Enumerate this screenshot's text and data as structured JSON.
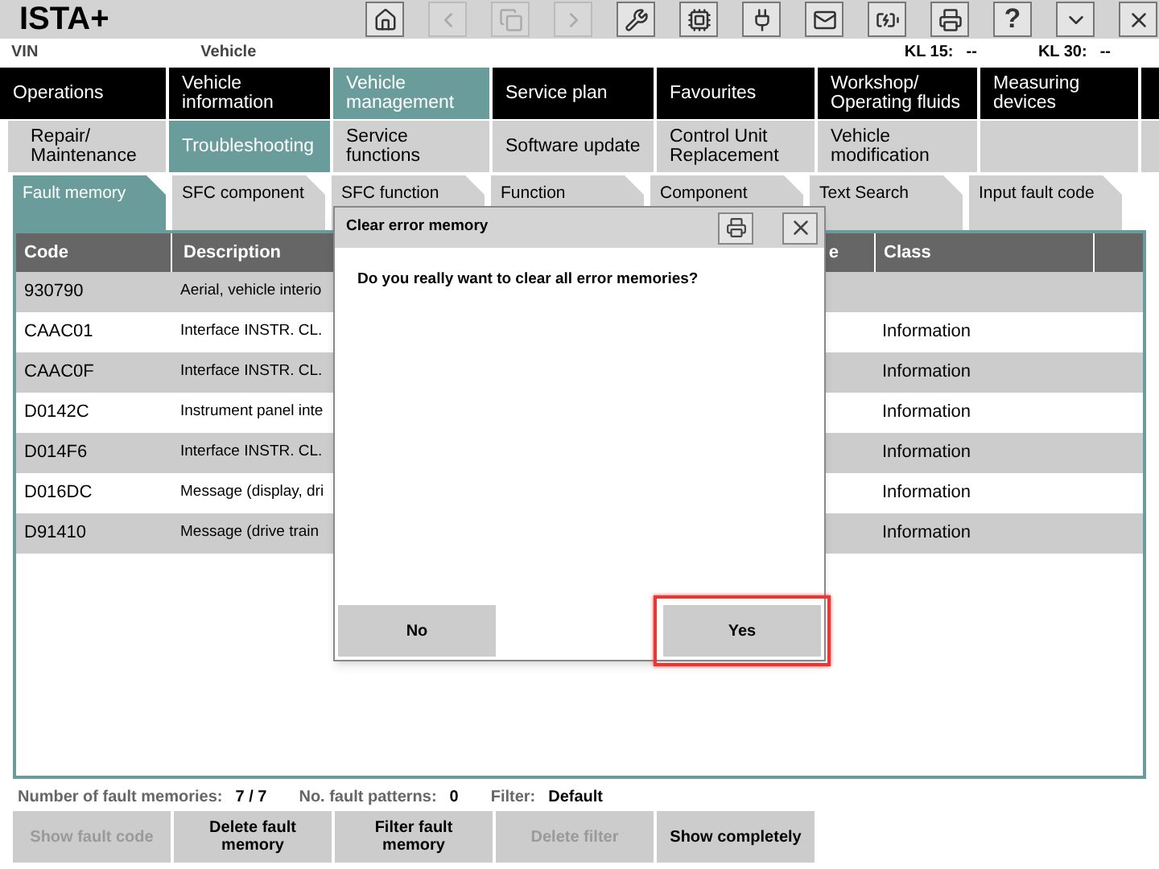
{
  "app_title": "ISTA+",
  "toolbar": [
    {
      "kind": "home",
      "disabled": false
    },
    {
      "kind": "back",
      "disabled": true
    },
    {
      "kind": "copy",
      "disabled": true
    },
    {
      "kind": "forward",
      "disabled": true
    },
    {
      "kind": "wrench",
      "disabled": false
    },
    {
      "kind": "module",
      "disabled": false
    },
    {
      "kind": "plug",
      "disabled": false
    },
    {
      "kind": "mail",
      "disabled": false
    },
    {
      "kind": "battery",
      "disabled": false
    },
    {
      "kind": "printer",
      "disabled": false
    },
    {
      "kind": "text",
      "label": "?",
      "disabled": false
    },
    {
      "kind": "dropdown",
      "disabled": false
    },
    {
      "kind": "close",
      "disabled": false
    }
  ],
  "vehicle_bar": {
    "vin_label": "VIN",
    "vehicle_label": "Vehicle",
    "kl15_label": "KL 15:",
    "kl15_value": "--",
    "kl30_label": "KL 30:",
    "kl30_value": "--"
  },
  "main_nav": [
    {
      "label": "Operations",
      "selected": false
    },
    {
      "label": "Vehicle information",
      "selected": false
    },
    {
      "label": "Vehicle management",
      "selected": true
    },
    {
      "label": "Service plan",
      "selected": false
    },
    {
      "label": "Favourites",
      "selected": false
    },
    {
      "label": "Workshop/ Operating fluids",
      "selected": false
    },
    {
      "label": "Measuring devices",
      "selected": false
    }
  ],
  "sub_nav": [
    {
      "label": "Repair/ Maintenance",
      "selected": false
    },
    {
      "label": "Troubleshooting",
      "selected": true
    },
    {
      "label": "Service functions",
      "selected": false
    },
    {
      "label": "Software update",
      "selected": false
    },
    {
      "label": "Control Unit Replacement",
      "selected": false
    },
    {
      "label": "Vehicle modification",
      "selected": false
    }
  ],
  "tabs": [
    {
      "label": "Fault memory",
      "selected": true
    },
    {
      "label": "SFC component",
      "selected": false
    },
    {
      "label": "SFC function",
      "selected": false
    },
    {
      "label": "Function",
      "selected": false
    },
    {
      "label": "Component",
      "selected": false
    },
    {
      "label": "Text Search",
      "selected": false
    },
    {
      "label": "Input fault code",
      "selected": false
    }
  ],
  "table": {
    "columns": [
      "Code",
      "Description",
      "e",
      "Class"
    ],
    "rows": [
      {
        "code": "930790",
        "description": "Aerial, vehicle interio"
      },
      {
        "code": "CAAC01",
        "description": "Interface INSTR. CL.",
        "class": "Information"
      },
      {
        "code": "CAAC0F",
        "description": "Interface INSTR. CL.",
        "class": "Information"
      },
      {
        "code": "D0142C",
        "description": "Instrument panel inte",
        "class": "Information"
      },
      {
        "code": "D014F6",
        "description": "Interface INSTR. CL.",
        "class": "Information"
      },
      {
        "code": "D016DC",
        "description": "Message (display, dri",
        "class": "Information"
      },
      {
        "code": "D91410",
        "description": "Message (drive train",
        "class": "Information"
      }
    ]
  },
  "summary": [
    {
      "label": "Number of fault memories:",
      "value": "7 / 7"
    },
    {
      "label": "No. fault patterns:",
      "value": "0"
    },
    {
      "label": "Filter:",
      "value": "Default"
    }
  ],
  "actions": [
    {
      "label": "Show fault code",
      "disabled": true
    },
    {
      "label": "Delete fault memory",
      "disabled": false
    },
    {
      "label": "Filter fault memory",
      "disabled": false
    },
    {
      "label": "Delete filter",
      "disabled": true
    },
    {
      "label": "Show completely",
      "disabled": false
    }
  ],
  "dialog": {
    "title": "Clear error memory",
    "message": "Do you really want to clear all error memories?",
    "buttons": [
      {
        "label": "No",
        "highlighted": false
      },
      {
        "label": "Yes",
        "highlighted": true
      }
    ]
  }
}
